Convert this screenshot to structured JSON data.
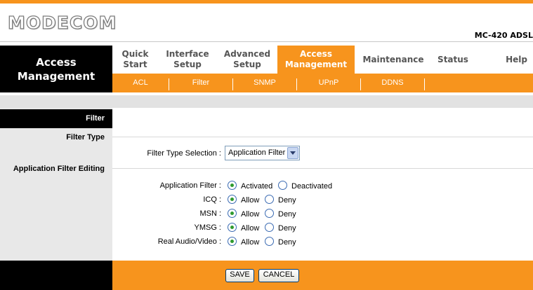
{
  "header": {
    "logo": "MODECOM",
    "model": "MC-420 ADSL"
  },
  "nav": {
    "section_title_line1": "Access",
    "section_title_line2": "Management",
    "tabs": [
      {
        "line1": "Quick",
        "line2": "Start"
      },
      {
        "line1": "Interface",
        "line2": "Setup"
      },
      {
        "line1": "Advanced",
        "line2": "Setup"
      },
      {
        "line1": "Access",
        "line2": "Management"
      },
      {
        "line1": "Maintenance",
        "line2": ""
      },
      {
        "line1": "Status",
        "line2": ""
      },
      {
        "line1": "Help",
        "line2": ""
      }
    ],
    "active_tab": "Access Management",
    "subtabs": [
      "ACL",
      "Filter",
      "SNMP",
      "UPnP",
      "DDNS"
    ]
  },
  "sidebar": {
    "filter": "Filter",
    "filter_type": "Filter Type",
    "app_filter_editing": "Application Filter Editing"
  },
  "form": {
    "filter_type_label": "Filter Type Selection :",
    "filter_type_value": "Application Filter",
    "rows": [
      {
        "label": "Application Filter :",
        "opt1": "Activated",
        "opt2": "Deactivated",
        "selected": "Activated"
      },
      {
        "label": "ICQ :",
        "opt1": "Allow",
        "opt2": "Deny",
        "selected": "Allow"
      },
      {
        "label": "MSN :",
        "opt1": "Allow",
        "opt2": "Deny",
        "selected": "Allow"
      },
      {
        "label": "YMSG :",
        "opt1": "Allow",
        "opt2": "Deny",
        "selected": "Allow"
      },
      {
        "label": "Real Audio/Video :",
        "opt1": "Allow",
        "opt2": "Deny",
        "selected": "Allow"
      }
    ]
  },
  "buttons": {
    "save": "SAVE",
    "cancel": "CANCEL"
  },
  "colors": {
    "accent": "#f7941d",
    "nav_black": "#000000",
    "sidebar_gray": "#e8e8e8"
  }
}
